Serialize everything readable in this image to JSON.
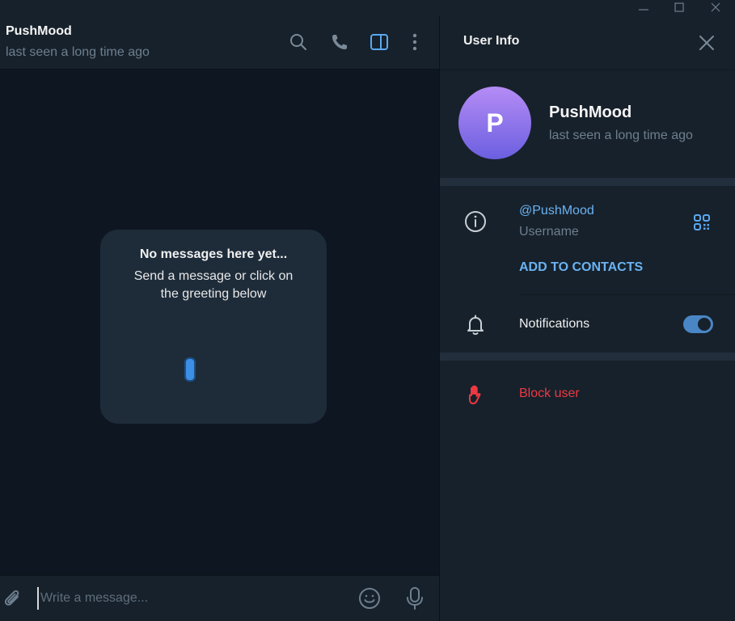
{
  "chat": {
    "title": "PushMood",
    "status": "last seen a long time ago",
    "empty_state": {
      "title": "No messages here yet...",
      "text": "Send a message or click on the greeting below"
    },
    "composer": {
      "placeholder": "Write a message..."
    },
    "header_icons": [
      "search-icon",
      "phone-icon",
      "sidebar-toggle-icon",
      "more-vertical-icon"
    ]
  },
  "info": {
    "title": "User Info",
    "profile": {
      "avatar_letter": "P",
      "name": "PushMood",
      "status": "last seen a long time ago"
    },
    "username": {
      "value": "@PushMood",
      "label": "Username"
    },
    "add_contacts_label": "ADD TO CONTACTS",
    "notifications": {
      "label": "Notifications",
      "enabled": true
    },
    "block_label": "Block user"
  },
  "colors": {
    "accent": "#6ab3f3",
    "danger": "#ec3942",
    "panel": "#17212b",
    "background": "#0e1621"
  }
}
